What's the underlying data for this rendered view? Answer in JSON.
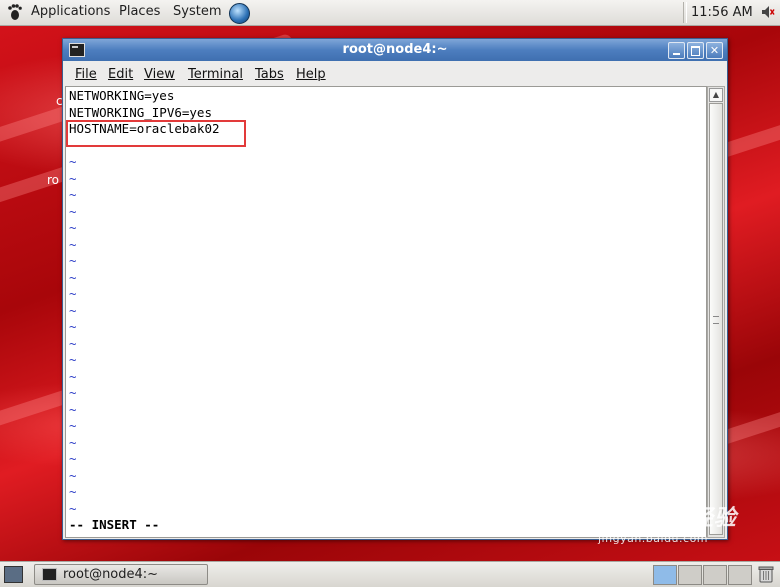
{
  "top_panel": {
    "menus": [
      "Applications",
      "Places",
      "System"
    ],
    "clock": "11:56 AM",
    "icons": [
      "gnome-foot-icon",
      "globe-icon",
      "volume-icon"
    ]
  },
  "desktop_fragments": [
    "c",
    "ro"
  ],
  "window": {
    "title": "root@node4:~",
    "controls": [
      "minimize",
      "maximize",
      "close"
    ],
    "menubar": [
      "File",
      "Edit",
      "View",
      "Terminal",
      "Tabs",
      "Help"
    ],
    "terminal": {
      "lines": [
        "NETWORKING=yes",
        "NETWORKING_IPV6=yes",
        "HOSTNAME=oraclebak02"
      ],
      "tilde_char": "~",
      "tilde_count": 23,
      "mode_line": "-- INSERT --",
      "highlight_color": "#e23a3a",
      "tilde_color": "#2f40c8"
    }
  },
  "bottom_panel": {
    "task": "root@node4:~",
    "workspaces": 4,
    "active_workspace": 1
  },
  "watermark": {
    "logo": "Bai du 经验",
    "url": "jingyan.baidu.com"
  }
}
